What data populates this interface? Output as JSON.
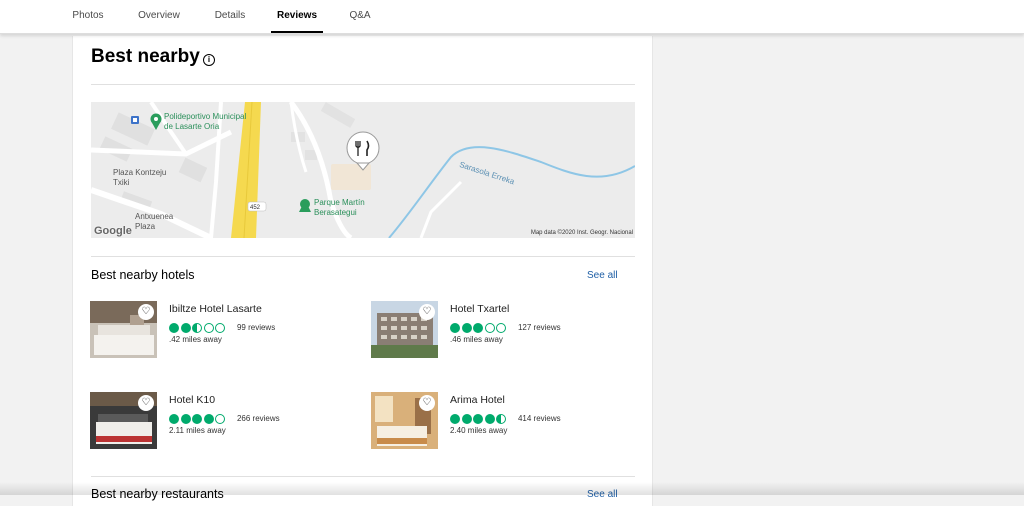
{
  "tabs": [
    {
      "label": "Photos"
    },
    {
      "label": "Overview"
    },
    {
      "label": "Details"
    },
    {
      "label": "Reviews",
      "active": true
    },
    {
      "label": "Q&A"
    }
  ],
  "section": {
    "title": "Best nearby",
    "info_icon": "info-icon"
  },
  "map": {
    "labels": {
      "poi1": "Polideportivo Municipal\nde Lasarte Oria",
      "plaza1": "Plaza Kontzeju\nTxiki",
      "plaza2": "Antxuenea\nPlaza",
      "park": "Parque Martín\nBerasategui",
      "river": "Sarasola Erreka",
      "road": "452"
    },
    "attribution": "Map data ©2020 Inst. Geogr. Nacional",
    "logo": "Google",
    "pin_icon": "restaurant-icon"
  },
  "hotels": {
    "title": "Best nearby hotels",
    "see_all": "See all",
    "items": [
      {
        "name": "Ibiltze Hotel Lasarte",
        "rating": 2.5,
        "reviews": "99 reviews",
        "distance": ".42 miles away"
      },
      {
        "name": "Hotel Txartel",
        "rating": 3,
        "reviews": "127 reviews",
        "distance": ".46 miles away"
      },
      {
        "name": "Hotel K10",
        "rating": 4,
        "reviews": "266 reviews",
        "distance": "2.11 miles away"
      },
      {
        "name": "Arima Hotel",
        "rating": 4.5,
        "reviews": "414 reviews",
        "distance": "2.40 miles away"
      }
    ]
  },
  "restaurants": {
    "title": "Best nearby restaurants",
    "see_all": "See all"
  },
  "colors": {
    "rating_green": "#00aa6c",
    "link_blue": "#1f5fa6",
    "map_road_yellow": "#f5d94f",
    "map_river_blue": "#8ec6e6"
  }
}
